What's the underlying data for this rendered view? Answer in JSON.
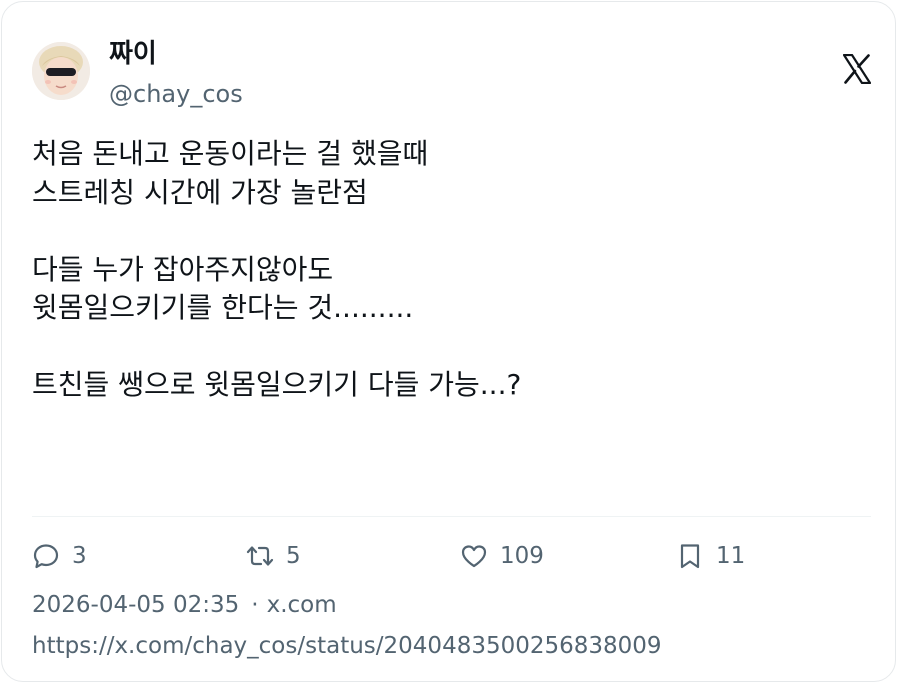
{
  "author": {
    "name": "짜이",
    "handle": "@chay_cos"
  },
  "tweet": {
    "lines": [
      "처음 돈내고 운동이라는 걸 했을때",
      "스트레칭 시간에 가장 놀란점",
      "",
      "다들 누가 잡아주지않아도",
      "윗몸일으키기를 한다는 것.........",
      "",
      "트친들 쌩으로 윗몸일으키기 다들 가능...?"
    ]
  },
  "actions": {
    "replies": "3",
    "retweets": "5",
    "likes": "109",
    "bookmarks": "11"
  },
  "meta": {
    "timestamp": "2026-04-05 02:35",
    "separator": "·",
    "source": "x.com",
    "url": "https://x.com/chay_cos/status/2040483500256838009"
  },
  "icons": {
    "logo": "x-logo-icon",
    "reply": "reply-icon",
    "retweet": "retweet-icon",
    "like": "heart-icon",
    "bookmark": "bookmark-icon"
  },
  "colors": {
    "text_primary": "#0f1419",
    "text_secondary": "#536471",
    "border": "#e6e9eb"
  }
}
